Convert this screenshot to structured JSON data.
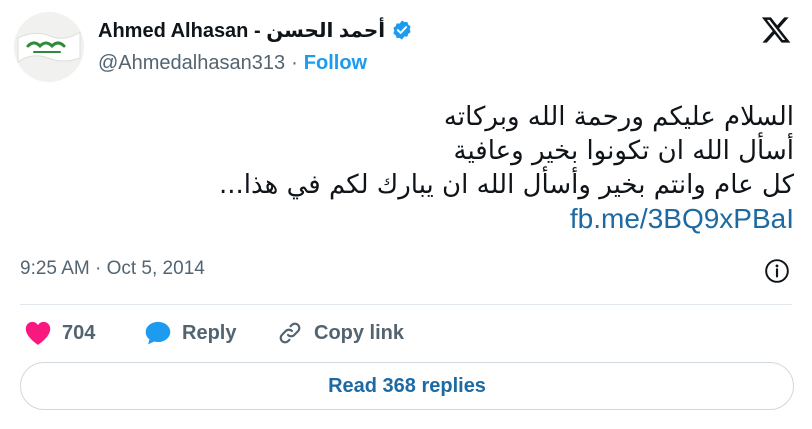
{
  "author": {
    "display_name": "Ahmed Alhasan - أحمد الحسن",
    "handle": "@Ahmedalhasan313",
    "separator": "·",
    "follow_label": "Follow",
    "avatar_text": "البيعة لله"
  },
  "tweet": {
    "lines": [
      "السلام عليكم ورحمة الله وبركاته",
      "أسأل الله ان تكونوا بخير وعافية",
      "كل عام وانتم بخير وأسأل الله ان يبارك لكم في هذا..."
    ],
    "link": "fb.me/3BQ9xPBaI",
    "timestamp": "9:25 AM · Oct 5, 2014"
  },
  "actions": {
    "like_count": "704",
    "reply_label": "Reply",
    "copy_label": "Copy link"
  },
  "read_replies_label": "Read 368 replies",
  "colors": {
    "verified": "#1d9bf0",
    "like": "#f91880",
    "reply": "#1d9bf0",
    "link": "#1d6aa3",
    "muted": "#536471"
  },
  "icons": {
    "brand": "x-logo-icon",
    "verified": "verified-badge-icon",
    "info": "info-icon",
    "like": "heart-icon",
    "reply": "speech-bubble-icon",
    "copy": "link-icon"
  }
}
